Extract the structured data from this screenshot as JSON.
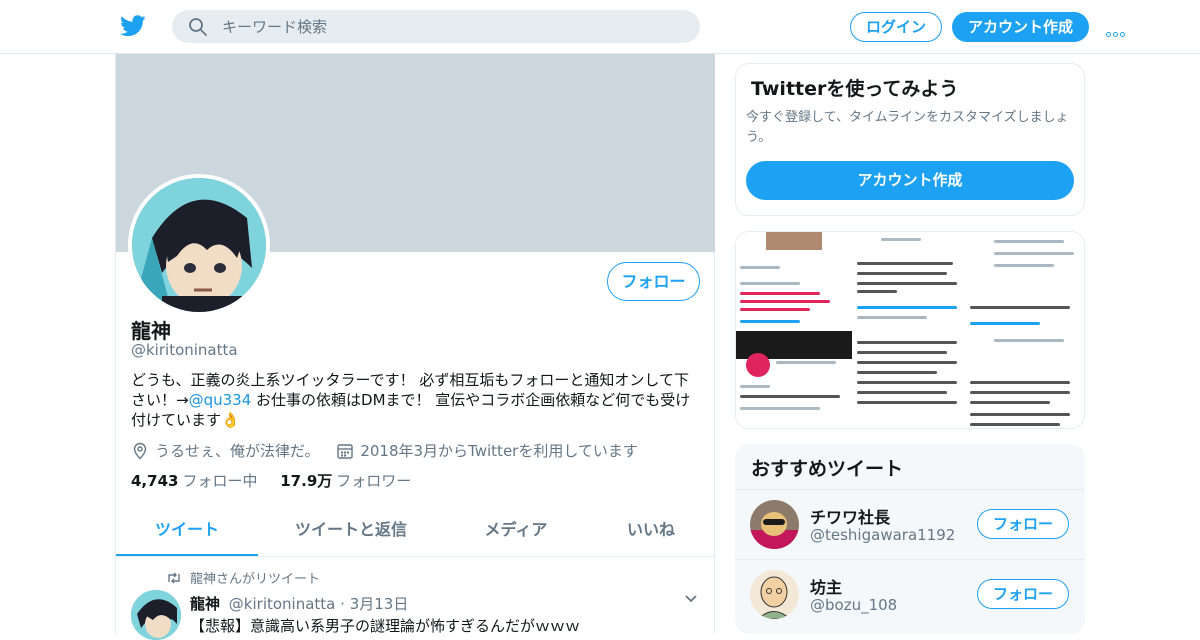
{
  "header": {
    "search_placeholder": "キーワード検索",
    "login_label": "ログイン",
    "signup_label": "アカウント作成"
  },
  "profile": {
    "follow_label": "フォロー",
    "name": "龍神",
    "handle": "@kiritoninatta",
    "bio_before": "どうも、正義の炎上系ツイッタラーです！ 必ず相互垢もフォローと通知オンして下さい！→",
    "bio_link": "@qu334",
    "bio_after": " お仕事の依頼はDMまで！ 宣伝やコラボ企画依頼など何でも受け付けています👌",
    "location": "うるせぇ、俺が法律だ。",
    "joined": "2018年3月からTwitterを利用しています",
    "following_count": "4,743",
    "following_label": "フォロー中",
    "followers_count": "17.9万",
    "followers_label": "フォロワー"
  },
  "tabs": [
    "ツイート",
    "ツイートと返信",
    "メディア",
    "いいね"
  ],
  "tweet": {
    "retweet_note": "龍神さんがリツイート",
    "name": "龍神",
    "handle": "@kiritoninatta",
    "date": "· 3月13日",
    "text": "【悲報】意識高い系男子の謎理論が怖すぎるんだがｗｗｗ"
  },
  "signup_card": {
    "title": "Twitterを使ってみよう",
    "desc": "今すぐ登録して、タイムラインをカスタマイズしましょう。",
    "button": "アカウント作成"
  },
  "recommended": {
    "title": "おすすめツイート",
    "users": [
      {
        "name": "チワワ社長",
        "handle": "@teshigawara1192",
        "button": "フォロー"
      },
      {
        "name": "坊主",
        "handle": "@bozu_108",
        "button": "フォロー"
      }
    ]
  },
  "colors": {
    "accent": "#1da1f2",
    "banner": "#ccd6dd",
    "muted": "#657786"
  }
}
